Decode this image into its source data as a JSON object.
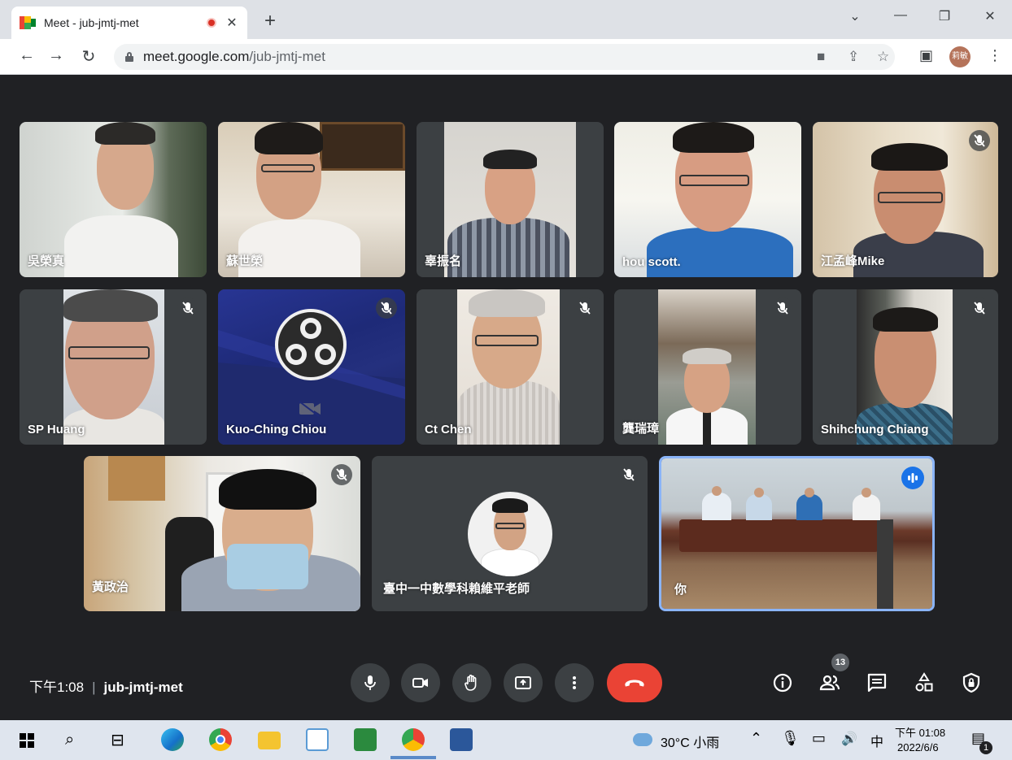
{
  "browser": {
    "tab_title": "Meet - jub-jmtj-met",
    "tab_close": "✕",
    "new_tab": "+",
    "url_host": "meet.google.com",
    "url_path": "/jub-jmtj-met",
    "profile_initials": "莉敏",
    "window_controls": {
      "chevron": "⌄",
      "minimize": "—",
      "restore": "❐",
      "close": "✕"
    }
  },
  "participants": [
    {
      "name": "吳榮真",
      "muted": false
    },
    {
      "name": "蘇世榮",
      "muted": false
    },
    {
      "name": "辜振名",
      "muted": false
    },
    {
      "name": "hou scott.",
      "muted": false
    },
    {
      "name": "江孟峰Mike",
      "muted": true
    },
    {
      "name": "SP Huang",
      "muted": true
    },
    {
      "name": "Kuo-Ching Chiou",
      "muted": true
    },
    {
      "name": "Ct Chen",
      "muted": true
    },
    {
      "name": "龔瑞璋",
      "muted": true
    },
    {
      "name": "Shihchung Chiang",
      "muted": true
    },
    {
      "name": "黃政治",
      "muted": true
    },
    {
      "name": "臺中一中數學科賴維平老師",
      "muted": true
    },
    {
      "name": "你",
      "muted": false,
      "speaking": true
    }
  ],
  "meeting": {
    "time": "下午1:08",
    "separator": "|",
    "code": "jub-jmtj-met",
    "people_count": "13"
  },
  "taskbar": {
    "weather": "30°C 小雨",
    "ime": "中",
    "time": "下午 01:08",
    "date": "2022/6/6",
    "notification_count": "1"
  },
  "colors": {
    "background": "#202124",
    "tile": "#3c4043",
    "hangup": "#ea4335",
    "active_border": "#8ab4f8",
    "speaking_badge": "#1a73e8"
  }
}
